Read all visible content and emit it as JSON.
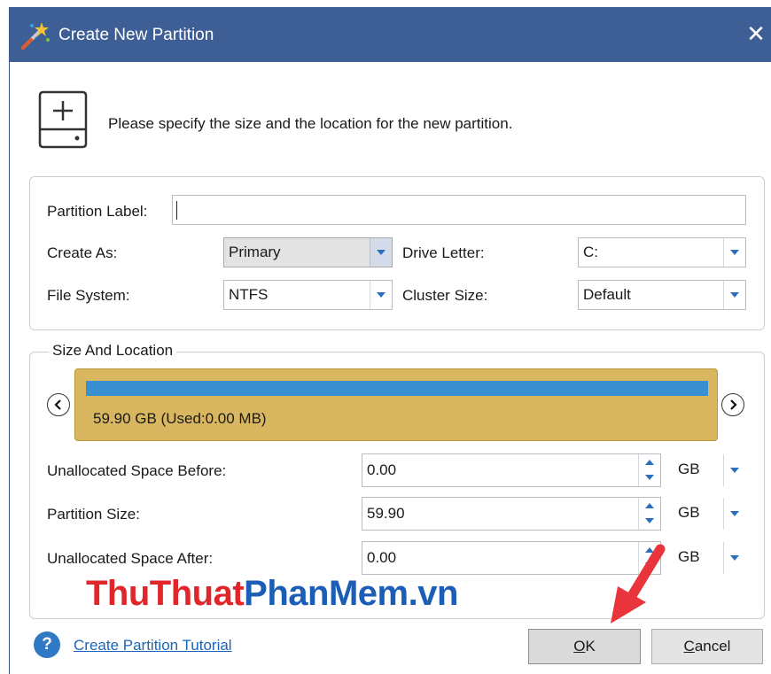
{
  "window": {
    "title": "Create New Partition",
    "close_glyph": "✕"
  },
  "intro_text": "Please specify the size and the location for the new partition.",
  "form": {
    "partition_label": {
      "label": "Partition Label:",
      "value": ""
    },
    "create_as": {
      "label": "Create As:",
      "value": "Primary"
    },
    "drive_letter": {
      "label": "Drive Letter:",
      "value": "C:"
    },
    "file_system": {
      "label": "File System:",
      "value": "NTFS"
    },
    "cluster_size": {
      "label": "Cluster Size:",
      "value": "Default"
    }
  },
  "size_location": {
    "title": "Size And Location",
    "partition_bar": {
      "info": "59.90 GB (Used:0.00 MB)",
      "used_fraction": 0.0
    },
    "unallocated_before": {
      "label": "Unallocated Space Before:",
      "value": "0.00",
      "unit": "GB"
    },
    "partition_size": {
      "label": "Partition Size:",
      "value": "59.90",
      "unit": "GB"
    },
    "unallocated_after": {
      "label": "Unallocated Space After:",
      "value": "0.00",
      "unit": "GB"
    }
  },
  "watermark": {
    "part1": "ThuThuat",
    "part2": "PhanMem.vn"
  },
  "footer": {
    "help_glyph": "?",
    "tutorial_link": "Create Partition Tutorial",
    "ok": {
      "mnemonic": "O",
      "rest": "K"
    },
    "cancel": {
      "mnemonic": "C",
      "rest": "ancel"
    }
  },
  "colors": {
    "titlebar": "#3e5e96",
    "partition_bar": "#d9b760",
    "partition_fill": "#3a8fd0",
    "accent": "#2a6fbe",
    "watermark_red": "#e0262b",
    "watermark_blue": "#1c5db5",
    "annotation_arrow": "#e8343a"
  },
  "icons": {
    "title_icon": "wizard-wand-icon",
    "disk_icon": "add-disk-icon",
    "help_icon": "help-circle-icon",
    "nav_left": "chevron-left-icon",
    "nav_right": "chevron-right-icon"
  }
}
